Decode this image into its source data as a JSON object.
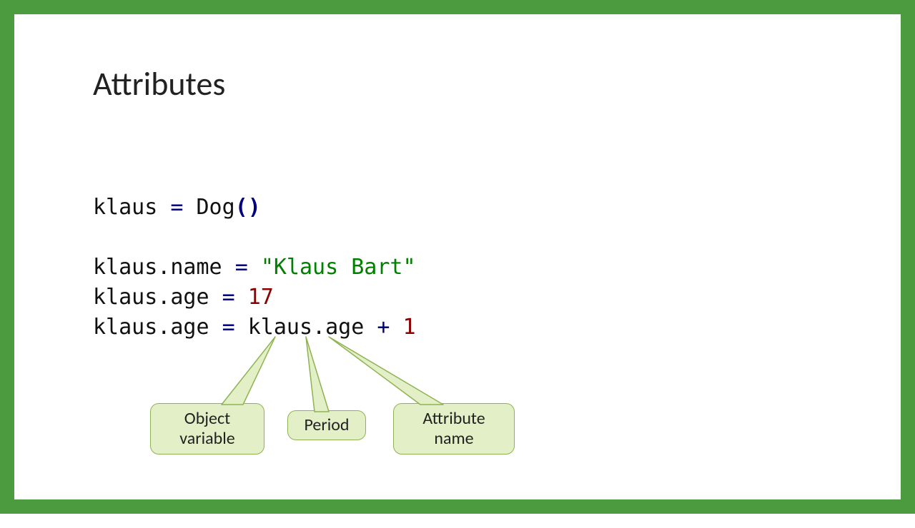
{
  "title": "Attributes",
  "code": {
    "l1_var": "klaus ",
    "l1_eq": "= ",
    "l1_cls": "Dog",
    "l1_paren": "()",
    "l2_left": "klaus.name ",
    "l2_eq": "= ",
    "l2_str": "\"Klaus Bart\"",
    "l3_left": "klaus.age ",
    "l3_eq": "= ",
    "l3_num": "17",
    "l4_left": "klaus.age ",
    "l4_eq": "= ",
    "l4_obj": "klaus",
    "l4_dot": ".",
    "l4_attr": "age ",
    "l4_plus": "+ ",
    "l4_num": "1"
  },
  "callouts": {
    "object_variable": "Object\nvariable",
    "period": "Period",
    "attribute_name": "Attribute\nname"
  },
  "colors": {
    "frame_border": "#4c9c3f",
    "callout_fill": "#e3efc7",
    "callout_border": "#8fb352",
    "op_color": "#000080",
    "str_color": "#008000",
    "num_color": "#8b0000"
  }
}
